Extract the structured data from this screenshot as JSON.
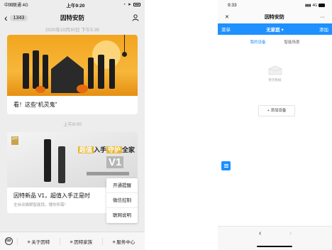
{
  "left": {
    "status": {
      "carrier": "中国联通 4G",
      "time": "上午9:20"
    },
    "nav": {
      "badge": "1343",
      "title": "因特安防"
    },
    "timestamp1": "2020年10月30日 下午5:39",
    "card1": {
      "caption": "看！这些“机灵鬼”"
    },
    "timestamp2": "上午8:00",
    "card2": {
      "promo_prefix": "超值",
      "promo_mid": "入手",
      "promo_tag": "守护",
      "promo_end": "全家",
      "promo_big": "V1",
      "logo_text": "因特",
      "caption": "因特新品 V1，超值入手正是时",
      "subcaption": "全自动猫眼智能锁，懂你所需！"
    },
    "popup": [
      "开通提醒",
      "微信控制",
      "联网说明"
    ],
    "bottom_menu": [
      "关于因特",
      "因特家族",
      "服务中心"
    ]
  },
  "right": {
    "status": {
      "time": "9:33",
      "net": "4G"
    },
    "nav": {
      "title": "因特安防",
      "more": "···"
    },
    "bar": {
      "menu": "菜单",
      "home": "无家庭",
      "add": "添加"
    },
    "tabs": [
      "我的设备",
      "智能场景"
    ],
    "empty_text": "暂无数据",
    "add_device": "+ 添加设备"
  }
}
